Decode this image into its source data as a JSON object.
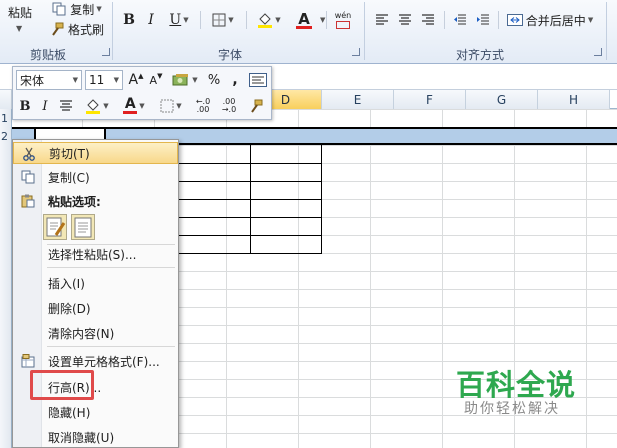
{
  "ribbon": {
    "paste_label": "粘贴",
    "copy_label": "复制",
    "format_painter_label": "格式刷",
    "group_clipboard": "剪贴板",
    "group_font": "字体",
    "group_alignment": "对齐方式",
    "merge_center_label": "合并后居中",
    "bold": "B",
    "italic": "I",
    "underline": "U",
    "font_color_glyph": "A",
    "wen_glyph": "wén"
  },
  "mini_toolbar": {
    "font_name": "宋体",
    "font_size": "11",
    "grow_font": "A",
    "shrink_font": "A",
    "percent": "%",
    "comma": ",",
    "bold": "B",
    "italic": "I",
    "font_color": "A",
    "inc_decimal": "←.0 .00",
    "dec_decimal": ".00 →.0"
  },
  "columns": [
    "D",
    "E",
    "F",
    "G",
    "H"
  ],
  "row_numbers": [
    "1",
    "2"
  ],
  "context_menu": {
    "items": [
      {
        "label": "剪切(T)",
        "icon": "scissors-icon",
        "highlighted": true
      },
      {
        "label": "复制(C)",
        "icon": "copy-icon"
      },
      {
        "label": "粘贴选项:",
        "icon": "paste-icon",
        "bold": true
      },
      {
        "label": "选择性粘贴(S)..."
      },
      {
        "label": "插入(I)"
      },
      {
        "label": "删除(D)"
      },
      {
        "label": "清除内容(N)"
      },
      {
        "label": "设置单元格格式(F)...",
        "icon": "format-cells-icon"
      },
      {
        "label": "行高(R)..."
      },
      {
        "label": "隐藏(H)"
      },
      {
        "label": "取消隐藏(U)"
      }
    ]
  },
  "watermark": {
    "title": "百科全说",
    "subtitle": "助你轻松解决"
  },
  "colors": {
    "selection_fill": "#b3cde8",
    "highlight_box": "#e04a4a",
    "watermark_green": "#2ea84f",
    "font_color_red": "#e02020",
    "fill_color_yellow": "#ffe600"
  }
}
